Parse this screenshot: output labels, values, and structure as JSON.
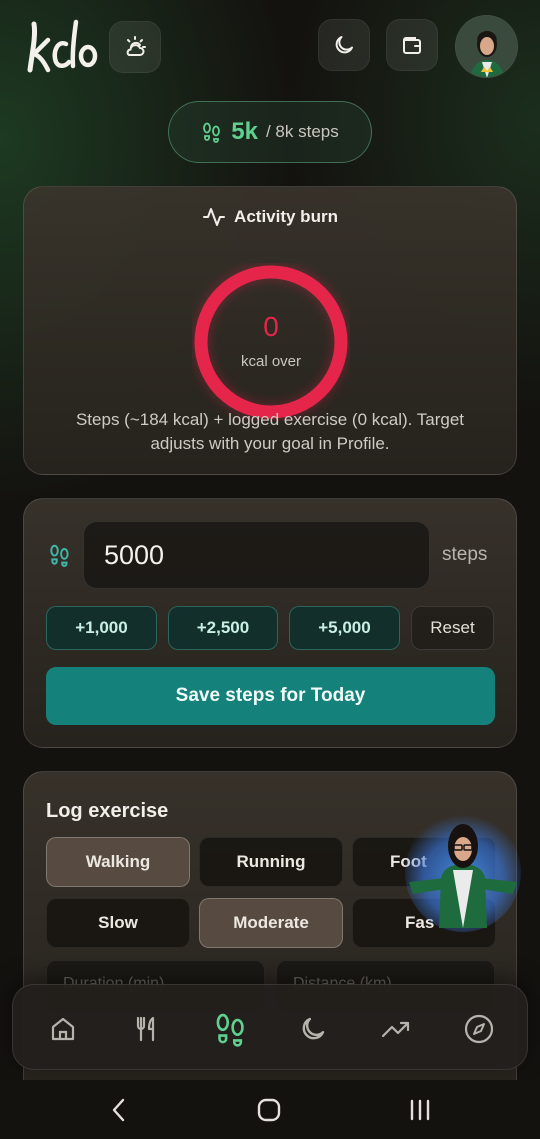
{
  "header": {
    "logo_text": "kclo",
    "icons": [
      "weather-icon",
      "moon-icon",
      "wallet-icon",
      "avatar"
    ]
  },
  "steps_pill": {
    "value": "5k",
    "goal_text": "/ 8k steps"
  },
  "activity_burn": {
    "title": "Activity burn",
    "ring_value": "0",
    "ring_label": "kcal over",
    "ring_color": "#e5264a",
    "description": "Steps (~184 kcal) + logged exercise (0 kcal). Target adjusts with your goal in Profile."
  },
  "steps_entry": {
    "value": "5000",
    "unit": "steps",
    "chips": [
      "+1,000",
      "+2,500",
      "+5,000"
    ],
    "reset_label": "Reset",
    "save_label": "Save steps for Today"
  },
  "log_exercise": {
    "title": "Log exercise",
    "activity_types": [
      "Walking",
      "Running",
      "Foot"
    ],
    "active_activity": "Walking",
    "intensities": [
      "Slow",
      "Moderate",
      "Fas"
    ],
    "active_intensity": "Moderate",
    "duration_placeholder": "Duration (min)",
    "distance_placeholder": "Distance (km)"
  },
  "bottom_nav": {
    "items": [
      "home-icon",
      "food-icon",
      "steps-icon",
      "sleep-icon",
      "trends-icon",
      "explore-icon"
    ],
    "active": "steps-icon",
    "active_color": "#5fd08f"
  },
  "colors": {
    "accent_green": "#5fd08f",
    "accent_teal": "#14817a",
    "ring_red": "#e5264a"
  }
}
